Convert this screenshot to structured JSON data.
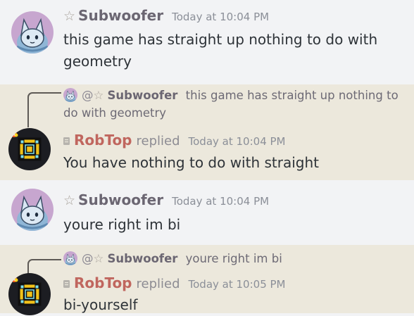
{
  "messages": [
    {
      "author": "Subwoofer",
      "timestamp": "Today at 10:04 PM",
      "text_line1": "this game has straight up nothing to do with",
      "text_line2": "geometry"
    },
    {
      "reply_to": {
        "mention": "@",
        "author": "Subwoofer",
        "text_line1": "this game has straight up nothing to",
        "text_line2": "do with geometry"
      },
      "author": "RobTop",
      "replied_label": "replied",
      "timestamp": "Today at 10:04 PM",
      "text": "You have nothing to do with straight"
    },
    {
      "author": "Subwoofer",
      "timestamp": "Today at 10:04 PM",
      "text": "youre right im bi"
    },
    {
      "reply_to": {
        "mention": "@",
        "author": "Subwoofer",
        "text": "youre right im bi"
      },
      "author": "RobTop",
      "replied_label": "replied",
      "timestamp": "Today at 10:05 PM",
      "text": "bi-yourself"
    }
  ],
  "icons": {
    "star": "☆",
    "subwoofer_avatar": "cat-avatar-icon",
    "robtop_avatar": "geometry-dash-cube-icon"
  },
  "colors": {
    "highlight_background": "#ece8dc",
    "background": "#f2f3f5",
    "robtop_name": "#c0665e",
    "subwoofer_name": "#6b6672"
  }
}
